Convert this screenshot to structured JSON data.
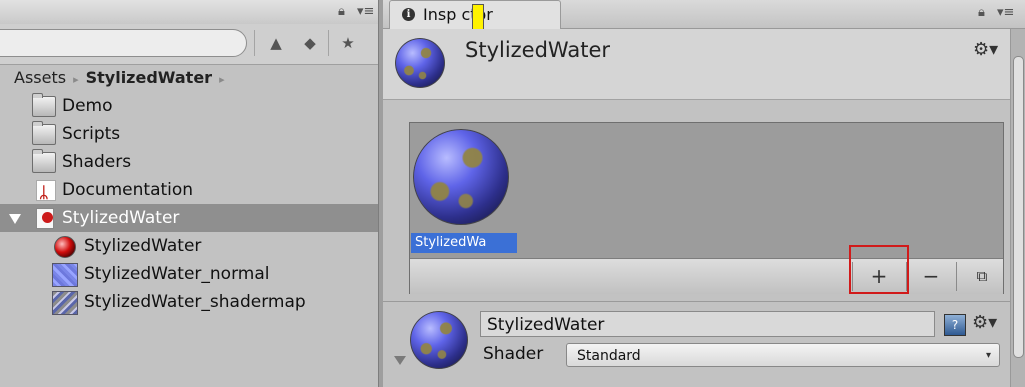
{
  "project": {
    "breadcrumb": [
      "Assets",
      "StylizedWater"
    ],
    "breadcrumb_separator": "▸",
    "tree": [
      {
        "label": "Demo",
        "icon": "folder-icon"
      },
      {
        "label": "Scripts",
        "icon": "folder-icon"
      },
      {
        "label": "Shaders",
        "icon": "folder-icon"
      },
      {
        "label": "Documentation",
        "icon": "pdf-icon"
      },
      {
        "label": "StylizedWater",
        "icon": "shader-file-icon",
        "selected": true
      },
      {
        "label": "StylizedWater",
        "icon": "material-icon"
      },
      {
        "label": "StylizedWater_normal",
        "icon": "normal-texture-icon"
      },
      {
        "label": "StylizedWater_shadermap",
        "icon": "shadermap-texture-icon"
      }
    ]
  },
  "inspector": {
    "tab_label": "Insp ctor",
    "info_glyph": "i",
    "header_name": "StylizedWater",
    "preview_label": "StylizedWa",
    "preview_buttons": [
      "+",
      "−"
    ],
    "material_name": "StylizedWater",
    "shader_label": "Shader",
    "shader_value": "Standard"
  },
  "colors": {
    "selection_blue": "#3b70d6",
    "highlight_red": "#d11a1a",
    "cursor_yellow": "#fff200"
  }
}
